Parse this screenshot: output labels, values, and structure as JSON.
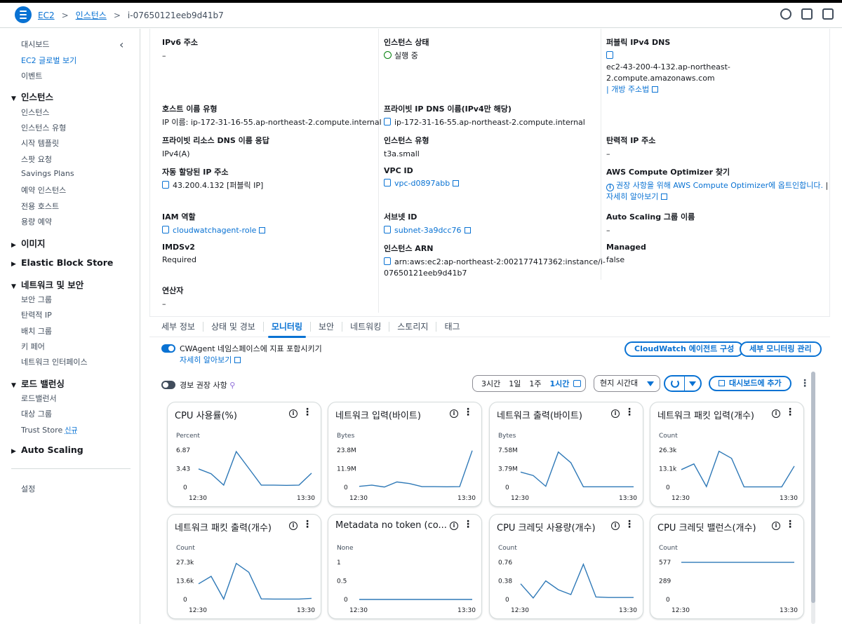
{
  "breadcrumb": {
    "root": "EC2",
    "section": "인스턴스",
    "current": "i-07650121eeb9d41b7"
  },
  "top_icons": [
    "notification-icon",
    "cloudshell-icon",
    "feedback-icon"
  ],
  "sidebar": {
    "top_items": [
      "대시보드",
      "EC2 글로벌 보기",
      "이벤트"
    ],
    "groups": [
      {
        "label": "인스턴스",
        "expanded": true,
        "items": [
          "인스턴스",
          "인스턴스 유형",
          "시작 템플릿",
          "스팟 요청",
          "Savings Plans",
          "예약 인스턴스",
          "전용 호스트",
          "용량 예약"
        ]
      },
      {
        "label": "이미지",
        "expanded": false,
        "items": []
      },
      {
        "label": "Elastic Block Store",
        "expanded": false,
        "items": []
      },
      {
        "label": "네트워크 및 보안",
        "expanded": true,
        "items": [
          "보안 그룹",
          "탄력적 IP",
          "배치 그룹",
          "키 페어",
          "네트워크 인터페이스"
        ]
      },
      {
        "label": "로드 밸런싱",
        "expanded": true,
        "items": [
          "로드밸런서",
          "대상 그룹",
          "Trust Store"
        ]
      },
      {
        "label": "Auto Scaling",
        "expanded": false,
        "items": []
      }
    ],
    "new_badge": "신규",
    "settings": "설정"
  },
  "details": {
    "ipv6": {
      "label": "IPv6 주소",
      "value": "–"
    },
    "state": {
      "label": "인스턴스 상태",
      "value": "실행 중"
    },
    "public_dns": {
      "label": "퍼블릭 IPv4 DNS",
      "value_line1": "ec2-43-200-4-132.ap-northeast-",
      "value_line2": "2.compute.amazonaws.com",
      "open_link": "개방 주소법"
    },
    "hostname_type": {
      "label": "호스트 이름 유형",
      "value": "IP 이름: ip-172-31-16-55.ap-northeast-2.compute.internal"
    },
    "private_dns": {
      "label": "프라이빗 IP DNS 이름(IPv4만 해당)",
      "value": "ip-172-31-16-55.ap-northeast-2.compute.internal"
    },
    "private_resource_dns": {
      "label": "프라이빗 리소스 DNS 이름 응답",
      "value": "IPv4(A)"
    },
    "instance_type": {
      "label": "인스턴스 유형",
      "value": "t3a.small"
    },
    "elastic_ip": {
      "label": "탄력적 IP 주소",
      "value": "–"
    },
    "auto_ip": {
      "label": "자동 할당된 IP 주소",
      "value": "43.200.4.132 [퍼블릭 IP]"
    },
    "vpc": {
      "label": "VPC ID",
      "value": "vpc-d0897abb"
    },
    "optimizer": {
      "label": "AWS Compute Optimizer 찾기",
      "value": "권장 사항을 위해 AWS Compute Optimizer에 옵트인합니다.",
      "learn_more": "자세히 알아보기"
    },
    "iam": {
      "label": "IAM 역할",
      "value": "cloudwatchagent-role"
    },
    "subnet": {
      "label": "서브넷 ID",
      "value": "subnet-3a9dcc76"
    },
    "asg": {
      "label": "Auto Scaling 그룹 이름",
      "value": "–"
    },
    "imds": {
      "label": "IMDSv2",
      "value": "Required"
    },
    "arn": {
      "label": "인스턴스 ARN",
      "value_line1": "arn:aws:ec2:ap-northeast-2:002177417362:instance/i-",
      "value_line2": "07650121eeb9d41b7"
    },
    "managed": {
      "label": "Managed",
      "value": "false"
    },
    "operator": {
      "label": "연산자",
      "value": "–"
    }
  },
  "tabs": [
    "세부 정보",
    "상태 및 경보",
    "모니터링",
    "보안",
    "네트워킹",
    "스토리지",
    "태그"
  ],
  "active_tab": "모니터링",
  "monitoring": {
    "cwagent_toggle": "CWAgent 네임스페이스에 지표 포함시키기",
    "learn_more": "자세히 알아보기",
    "agent_config_button": "CloudWatch 에이전트 구성",
    "manage_button": "세부 모니터링 관리",
    "alarm_toggle": "경보 권장 사항",
    "ranges": [
      "3시간",
      "1일",
      "1주",
      "1시간"
    ],
    "selected_range": "1시간",
    "timezone": "현지 시간대",
    "add_dashboard": "대시보드에 추가"
  },
  "colors": {
    "accent": "#0972d3",
    "line": "#2f79b7",
    "success": "#037f0c"
  },
  "charts": [
    {
      "title": "CPU 사용률(%)",
      "unit": "Percent",
      "ticks": [
        "6.87",
        "3.43",
        "0"
      ],
      "x_start": "12:30",
      "x_end": "13:30",
      "ymax": 6.87,
      "values": [
        3.4,
        2.5,
        0.4,
        6.6,
        3.5,
        0.4,
        0.4,
        0.35,
        0.4,
        2.6
      ]
    },
    {
      "title": "네트워크 입력(바이트)",
      "unit": "Bytes",
      "ticks": [
        "23.8M",
        "11.9M",
        "0"
      ],
      "x_start": "12:30",
      "x_end": "13:30",
      "ymax": 23.8,
      "values": [
        0.6,
        1.4,
        0.2,
        3.4,
        2.4,
        0.4,
        0.4,
        0.3,
        0.4,
        23.5
      ]
    },
    {
      "title": "네트워크 출력(바이트)",
      "unit": "Bytes",
      "ticks": [
        "7.58M",
        "3.79M",
        "0"
      ],
      "x_start": "12:30",
      "x_end": "13:30",
      "ymax": 7.58,
      "values": [
        3.1,
        2.4,
        0.2,
        7.2,
        5.0,
        0.1,
        0.1,
        0.1,
        0.1,
        0.1
      ]
    },
    {
      "title": "네트워크 패킷 입력(개수)",
      "unit": "Count",
      "ticks": [
        "26.3k",
        "13.1k",
        "0"
      ],
      "x_start": "12:30",
      "x_end": "13:30",
      "ymax": 26.3,
      "values": [
        12.5,
        16.5,
        0.5,
        25.5,
        20.5,
        0.3,
        0.3,
        0.3,
        0.3,
        15.0
      ]
    },
    {
      "title": "네트워크 패킷 출력(개수)",
      "unit": "Count",
      "ticks": [
        "27.3k",
        "13.6k",
        "0"
      ],
      "x_start": "12:30",
      "x_end": "13:30",
      "ymax": 27.3,
      "values": [
        11.5,
        17.0,
        0.3,
        26.5,
        20.0,
        0.4,
        0.3,
        0.3,
        0.3,
        0.8
      ]
    },
    {
      "title": "Metadata no token (co...",
      "unit": "None",
      "ticks": [
        "1",
        "0.5",
        "0"
      ],
      "x_start": "12:30",
      "x_end": "13:30",
      "ymax": 1,
      "values": [
        0,
        0,
        0,
        0,
        0,
        0,
        0,
        0,
        0,
        0
      ]
    },
    {
      "title": "CPU 크레딧 사용량(개수)",
      "unit": "Count",
      "ticks": [
        "0.76",
        "0.38",
        "0"
      ],
      "x_start": "12:30",
      "x_end": "13:30",
      "ymax": 0.76,
      "values": [
        0.32,
        0.03,
        0.38,
        0.2,
        0.1,
        0.72,
        0.05,
        0.04,
        0.04,
        0.04
      ]
    },
    {
      "title": "CPU 크레딧 밸런스(개수)",
      "unit": "Count",
      "ticks": [
        "577",
        "289",
        "0"
      ],
      "x_start": "12:30",
      "x_end": "13:30",
      "ymax": 577,
      "values": [
        576,
        576,
        576,
        576,
        576,
        576,
        576,
        576,
        576,
        576
      ]
    }
  ]
}
